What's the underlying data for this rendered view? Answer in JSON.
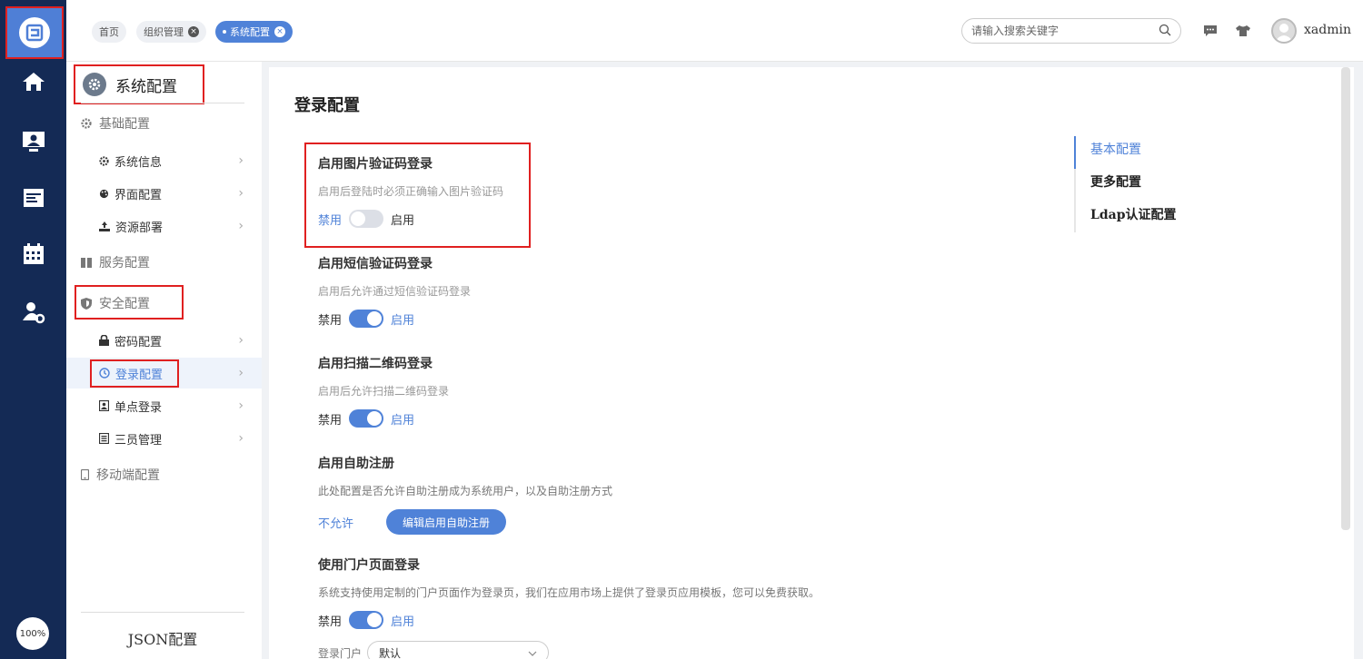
{
  "rail": {
    "logo_icon": "app-logo-icon",
    "items": [
      {
        "icon": "home-icon"
      },
      {
        "icon": "monitor-user-icon"
      },
      {
        "icon": "calendar-list-icon"
      },
      {
        "icon": "calendar-grid-icon"
      },
      {
        "icon": "user-gear-icon"
      }
    ],
    "zoom": "100%"
  },
  "topbar": {
    "tabs": [
      {
        "label": "首页"
      },
      {
        "label": "组织管理"
      },
      {
        "label": "系统配置"
      }
    ],
    "search_placeholder": "请输入搜索关键字",
    "username": "xadmin"
  },
  "sidebar": {
    "title": "系统配置",
    "groups": {
      "basic": "基础配置",
      "service": "服务配置",
      "security": "安全配置",
      "mobile": "移动端配置"
    },
    "basic_items": [
      "系统信息",
      "界面配置",
      "资源部署"
    ],
    "security_items": [
      "密码配置",
      "登录配置",
      "单点登录",
      "三员管理"
    ],
    "json_label": "JSON配置"
  },
  "main": {
    "title": "登录配置",
    "off_label": "禁用",
    "on_label": "启用",
    "settings": [
      {
        "title": "启用图片验证码登录",
        "desc": "启用后登陆时必须正确输入图片验证码",
        "enabled": false
      },
      {
        "title": "启用短信验证码登录",
        "desc": "启用后允许通过短信验证码登录",
        "enabled": true
      },
      {
        "title": "启用扫描二维码登录",
        "desc": "启用后允许扫描二维码登录",
        "enabled": true
      }
    ],
    "self_register": {
      "title": "启用自助注册",
      "desc": "此处配置是否允许自助注册成为系统用户，以及自助注册方式",
      "status": "不允许",
      "button": "编辑启用自助注册"
    },
    "portal": {
      "title": "使用门户页面登录",
      "desc": "系统支持使用定制的门户页面作为登录页，我们在应用市场上提供了登录页应用模板，您可以免费获取。",
      "enabled": true,
      "select_label": "登录门户",
      "select_value": "默认"
    },
    "anchors": [
      "基本配置",
      "更多配置",
      "Ldap认证配置"
    ]
  },
  "colors": {
    "accent": "#4f82d8",
    "rail": "#142a55",
    "highlight": "#e02020"
  }
}
